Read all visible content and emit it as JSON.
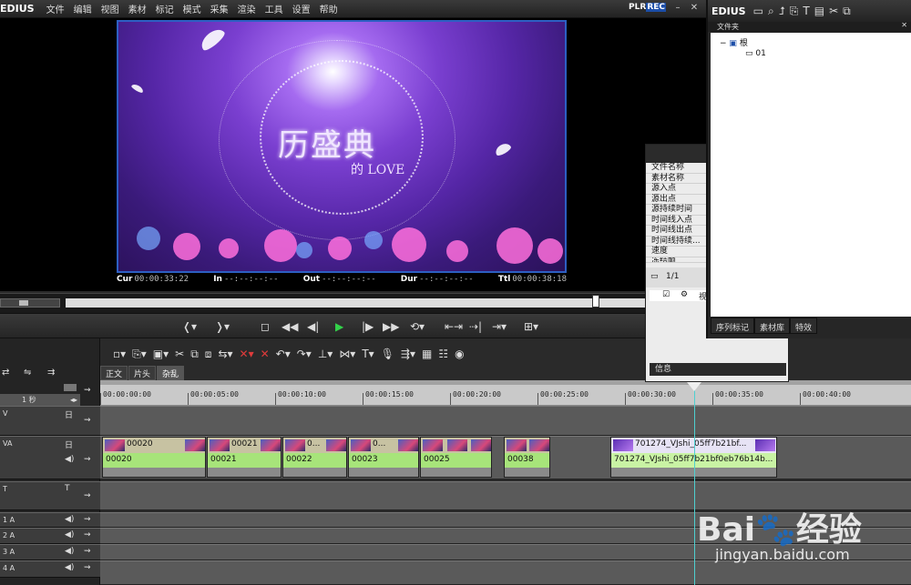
{
  "app": {
    "logo": "EDIUS",
    "plr": "PLR",
    "rec": "REC"
  },
  "menu": [
    "文件",
    "编辑",
    "视图",
    "素材",
    "标记",
    "模式",
    "采集",
    "渲染",
    "工具",
    "设置",
    "帮助"
  ],
  "preview": {
    "title_text": "历盛典",
    "love_text": "的 LOVE",
    "timecodes": [
      {
        "label": "Cur",
        "value": "00:00:33:22"
      },
      {
        "label": "In",
        "value": "--:--:--:--"
      },
      {
        "label": "Out",
        "value": "--:--:--:--"
      },
      {
        "label": "Dur",
        "value": "--:--:--:--"
      },
      {
        "label": "Ttl",
        "value": "00:00:38:18"
      }
    ]
  },
  "timeline": {
    "tabs": [
      "正文",
      "片头",
      "杂乱"
    ],
    "scale": "1 秒",
    "ruler": [
      "00:00:00:00",
      "00:00:05:00",
      "00:00:10:00",
      "00:00:15:00",
      "00:00:20:00",
      "00:00:25:00",
      "00:00:30:00",
      "00:00:35:00",
      "00:00:40:00"
    ],
    "tracks": {
      "v": "V",
      "va": "VA",
      "t": "T",
      "a1": "1 A",
      "a2": "2 A",
      "a3": "3 A",
      "a4": "4 A"
    },
    "clips": [
      {
        "video": "00020",
        "audio": "00020"
      },
      {
        "video": "00021",
        "audio": "00021"
      },
      {
        "video": "0...",
        "audio": "00022"
      },
      {
        "video": "0...",
        "audio": "00023"
      },
      {
        "video": "",
        "audio": "00025"
      },
      {
        "video": "",
        "audio": "00038"
      },
      {
        "video": "701274_VJshi_05ff7b21bf...",
        "audio": "701274_VJshi_05ff7b21bf0eb76b14b..."
      }
    ]
  },
  "info_panel": {
    "rows": [
      "文件名称",
      "素材名称",
      "源入点",
      "源出点",
      "源持续时间",
      "时间线入点",
      "时间线出点",
      "时间线持续...",
      "速度",
      "冻结帧"
    ],
    "page": "1/1",
    "check_label": "视",
    "footer": "信息"
  },
  "bin": {
    "logo": "EDIUS",
    "folder_header": "文件夹",
    "root": "根",
    "child": "01",
    "tabs": [
      "序列标记",
      "素材库",
      "特效"
    ]
  },
  "watermark": {
    "logo": "Bai🐾经验",
    "url": "jingyan.baidu.com"
  }
}
